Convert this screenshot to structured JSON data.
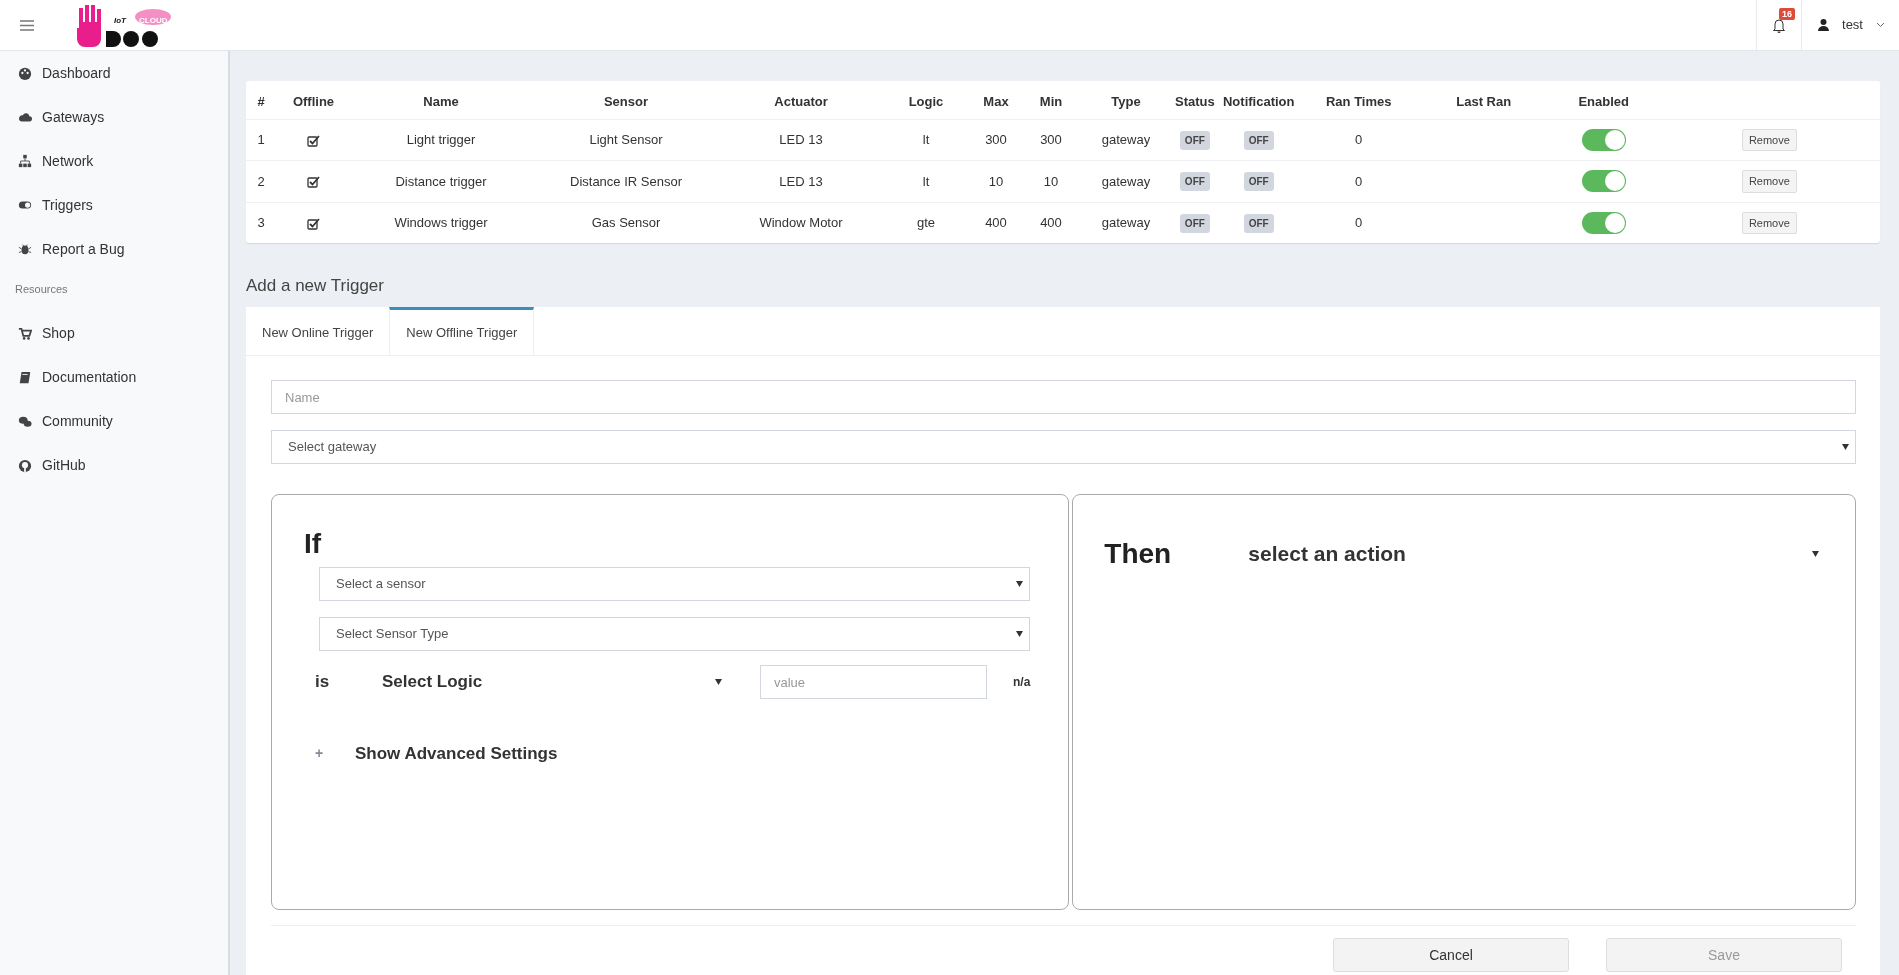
{
  "header": {
    "brand": {
      "tag": "IoT",
      "cloud": "CLOUD"
    },
    "notifications": {
      "count": "16"
    },
    "user": {
      "name": "test"
    }
  },
  "sidebar": {
    "items": [
      {
        "kind": "link",
        "label": "Dashboard"
      },
      {
        "kind": "link",
        "label": "Gateways"
      },
      {
        "kind": "link",
        "label": "Network"
      },
      {
        "kind": "link",
        "label": "Triggers"
      },
      {
        "kind": "link",
        "label": "Report a Bug"
      },
      {
        "kind": "section",
        "label": "Resources"
      },
      {
        "kind": "link",
        "label": "Shop"
      },
      {
        "kind": "link",
        "label": "Documentation"
      },
      {
        "kind": "link",
        "label": "Community"
      },
      {
        "kind": "link",
        "label": "GitHub"
      }
    ]
  },
  "table": {
    "columns": [
      "#",
      "Offline",
      "Name",
      "Sensor",
      "Actuator",
      "Logic",
      "Max",
      "Min",
      "Type",
      "Status",
      "Notification",
      "Ran Times",
      "Last Ran",
      "Enabled"
    ],
    "rows": [
      {
        "index": "1",
        "offline": true,
        "name": "Light trigger",
        "sensor": "Light Sensor",
        "actuator": "LED 13",
        "logic": "lt",
        "max": "300",
        "min": "300",
        "type": "gateway",
        "status": "OFF",
        "notification": "OFF",
        "ran_times": "0",
        "enabled": true,
        "action": "Remove"
      },
      {
        "index": "2",
        "offline": true,
        "name": "Distance trigger",
        "sensor": "Distance IR Sensor",
        "actuator": "LED 13",
        "logic": "lt",
        "max": "10",
        "min": "10",
        "type": "gateway",
        "status": "OFF",
        "notification": "OFF",
        "ran_times": "0",
        "enabled": true,
        "action": "Remove"
      },
      {
        "index": "3",
        "offline": true,
        "name": "Windows trigger",
        "sensor": "Gas Sensor",
        "actuator": "Window Motor",
        "logic": "gte",
        "max": "400",
        "min": "400",
        "type": "gateway",
        "status": "OFF",
        "notification": "OFF",
        "ran_times": "0",
        "enabled": true,
        "action": "Remove"
      }
    ]
  },
  "form": {
    "title": "Add a new Trigger",
    "tabs": [
      {
        "label": "New Online Trigger",
        "selected": false
      },
      {
        "label": "New Offline Trigger",
        "selected": true
      }
    ],
    "name": {
      "placeholder": "Name"
    },
    "gateway": {
      "value": "Select gateway"
    },
    "if": {
      "heading": "If",
      "sensor": "Select a sensor",
      "sensor_type": "Select Sensor Type",
      "is_label": "is",
      "logic": "Select Logic",
      "value": {
        "placeholder": "value"
      },
      "unit": "n/a",
      "advanced_icon": "+",
      "advanced": "Show Advanced Settings"
    },
    "then": {
      "heading": "Then",
      "action": "select an action"
    },
    "buttons": [
      {
        "label": "Cancel",
        "disabled": false
      },
      {
        "label": "Save",
        "disabled": true
      }
    ]
  }
}
